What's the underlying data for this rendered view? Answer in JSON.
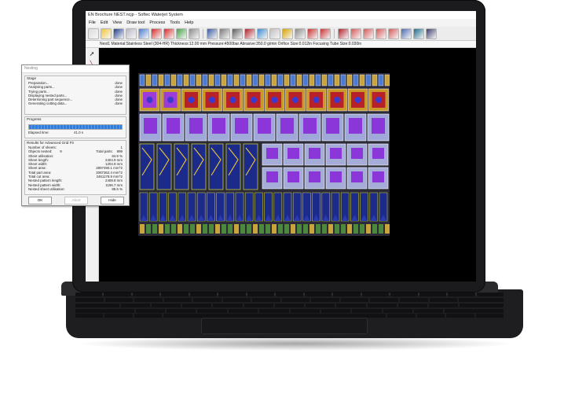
{
  "window": {
    "title": "EN Brochure NEST.ncjp - Softec Waterjet System",
    "menu": [
      "File",
      "Edit",
      "View",
      "Draw tool",
      "Process",
      "Tools",
      "Help"
    ]
  },
  "status_line": "Nest1  Material:Stainless Steel (304-HR)  Thickness:12.00 mm  Pressure:4500bar  Abrasive:350.0 g/min  Orifice Size:0.012in  Focusing Tube Size:0.030in",
  "dialog": {
    "title": "Nesting",
    "stage_label": "Stage",
    "stages": [
      {
        "name": "Preparation...",
        "status": "done"
      },
      {
        "name": "Analysing parts...",
        "status": "done"
      },
      {
        "name": "Trying parts...",
        "status": "done"
      },
      {
        "name": "Displaying nested parts...",
        "status": "done"
      },
      {
        "name": "Determining part sequence...",
        "status": "done"
      },
      {
        "name": "Generating cutting data...",
        "status": "done"
      }
    ],
    "progress_label": "Progress",
    "progress_fraction": 1.0,
    "elapsed_label": "Elapsed time:",
    "elapsed_value": "41.0 s",
    "results_label": "Results for Advanced Grid Fit",
    "number_of_sheets_label": "Number of sheets:",
    "number_of_sheets": "1",
    "objects_nested_label": "Objects nested:",
    "objects_nested": "9",
    "total_parts_label": "Total parts:",
    "total_parts": "899",
    "results": [
      {
        "label": "Sheet utilisation:",
        "value": "84.9 %"
      },
      {
        "label": "Sheet length:",
        "value": "2404.9 mm"
      },
      {
        "label": "Sheet width:",
        "value": "1204.9 mm"
      },
      {
        "label": "Sheet area:",
        "value": "2897490.1 mm^2"
      },
      {
        "label": "Total part area:",
        "value": "2087362.4 mm^2"
      },
      {
        "label": "Total cut area:",
        "value": "2461178.9 mm^2"
      },
      {
        "label": "Nested pattern length:",
        "value": "2408.8 mm"
      },
      {
        "label": "Nested pattern width:",
        "value": "1196.7 mm"
      },
      {
        "label": "Nested sheet utilisation:",
        "value": "85.5 %"
      }
    ],
    "buttons": {
      "ok": "OK",
      "abort": "Abort",
      "hide": "Hide"
    }
  },
  "left_tools": [
    "pointer-icon",
    "line-icon",
    "arc-icon",
    "polyline-icon",
    "rectangle-icon",
    "rounded-rect-icon",
    "square-icon",
    "diamond-icon",
    "circle-icon",
    "circle-dot-icon",
    "ellipse-icon",
    "spiral-icon",
    "text-icon"
  ],
  "colors": {
    "brand_red": "#b0202a",
    "accent_blue": "#2f7de0"
  }
}
